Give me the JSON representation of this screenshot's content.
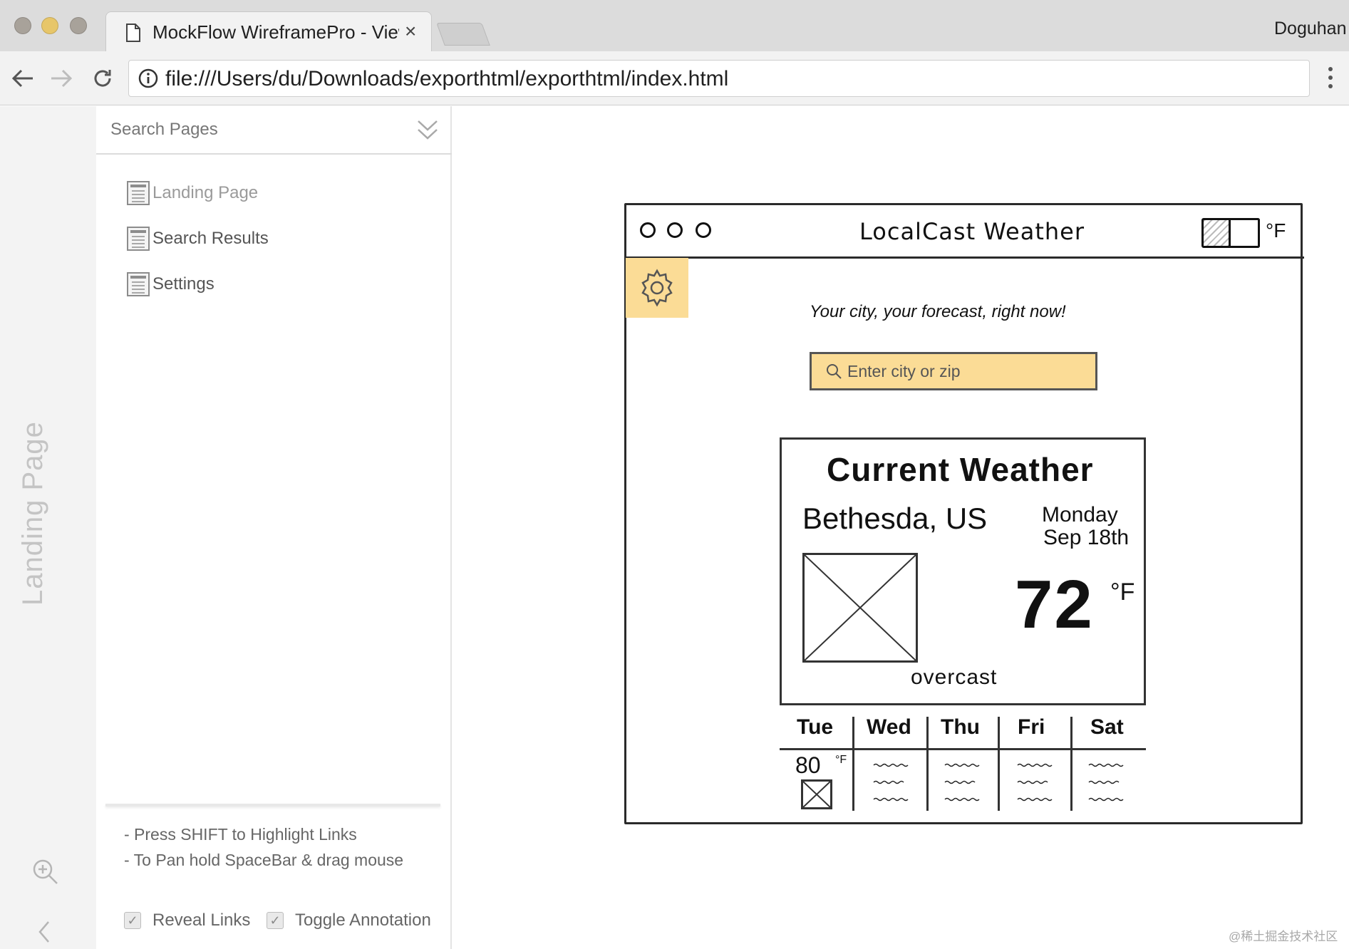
{
  "browser": {
    "tab_title": "MockFlow WireframePro - View",
    "tab_close": "×",
    "profile_name": "Doguhan",
    "url": "file:///Users/du/Downloads/exporthtml/exporthtml/index.html",
    "traffic_lights": [
      "#a8a29a",
      "#e7c66a",
      "#a8a29a"
    ]
  },
  "rail": {
    "label": "Landing Page"
  },
  "pages_panel": {
    "search_placeholder": "Search Pages",
    "pages": [
      {
        "label": "Landing Page",
        "active": true
      },
      {
        "label": "Search Results",
        "active": false
      },
      {
        "label": "Settings",
        "active": false
      }
    ],
    "hints": [
      "- Press SHIFT to Highlight Links",
      "- To Pan hold SpaceBar & drag mouse"
    ],
    "options": [
      {
        "label": "Reveal Links",
        "checked": true
      },
      {
        "label": "Toggle Annotation",
        "checked": true
      }
    ]
  },
  "wireframe": {
    "title": "LocalCast Weather",
    "unit_toggle": "°F",
    "tagline": "Your city, your forecast, right now!",
    "search_placeholder": "Enter city or zip",
    "accent_color": "#fbdc96",
    "current": {
      "title": "Current Weather",
      "city": "Bethesda, US",
      "day": "Monday",
      "date": "Sep 18th",
      "temperature": "72",
      "temperature_unit": "°F",
      "condition": "overcast"
    },
    "forecast": {
      "days": [
        "Tue",
        "Wed",
        "Thu",
        "Fri",
        "Sat"
      ],
      "tue_temp": "80",
      "tue_unit": "°F"
    }
  },
  "watermark": "@稀土掘金技术社区"
}
